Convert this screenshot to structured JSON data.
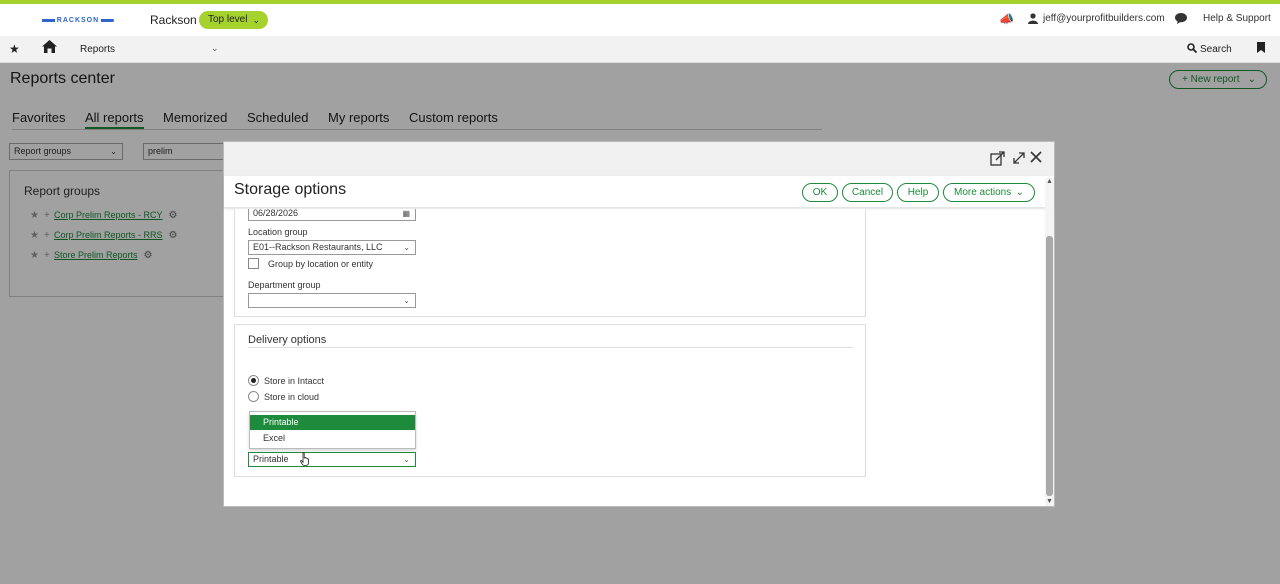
{
  "header": {
    "logo_text": "RACKSON",
    "company": "Rackson",
    "level": "Top level",
    "user_email": "jeff@yourprofitbuilders.com",
    "help": "Help & Support"
  },
  "nav": {
    "section": "Reports",
    "search": "Search"
  },
  "page": {
    "title": "Reports center",
    "new_report": "New report",
    "tabs": [
      "Favorites",
      "All reports",
      "Memorized",
      "Scheduled",
      "My reports",
      "Custom reports"
    ],
    "active_tab": "All reports",
    "group_filter": "Report groups",
    "search_value": "prelim",
    "report_groups_title": "Report groups",
    "report_groups": [
      "Corp Prelim Reports - RCY",
      "Corp Prelim Reports - RRS",
      "Store Prelim Reports"
    ]
  },
  "dialog": {
    "title": "Storage options",
    "buttons": {
      "ok": "OK",
      "cancel": "Cancel",
      "help": "Help",
      "more": "More actions"
    },
    "date_value": "06/28/2026",
    "location_group_label": "Location group",
    "location_group_value": "E01--Rackson Restaurants, LLC",
    "group_by_label": "Group by location or entity",
    "department_group_label": "Department group",
    "department_group_value": "",
    "delivery": {
      "title": "Delivery options",
      "store_intacct": "Store in Intacct",
      "store_cloud": "Store in cloud",
      "selected": "Store in Intacct",
      "format_options": [
        "Printable",
        "Excel"
      ],
      "format_value": "Printable"
    }
  },
  "colors": {
    "accent_green": "#1e8a3b",
    "lime": "#a6d22e",
    "brand_blue": "#2f64c8"
  }
}
